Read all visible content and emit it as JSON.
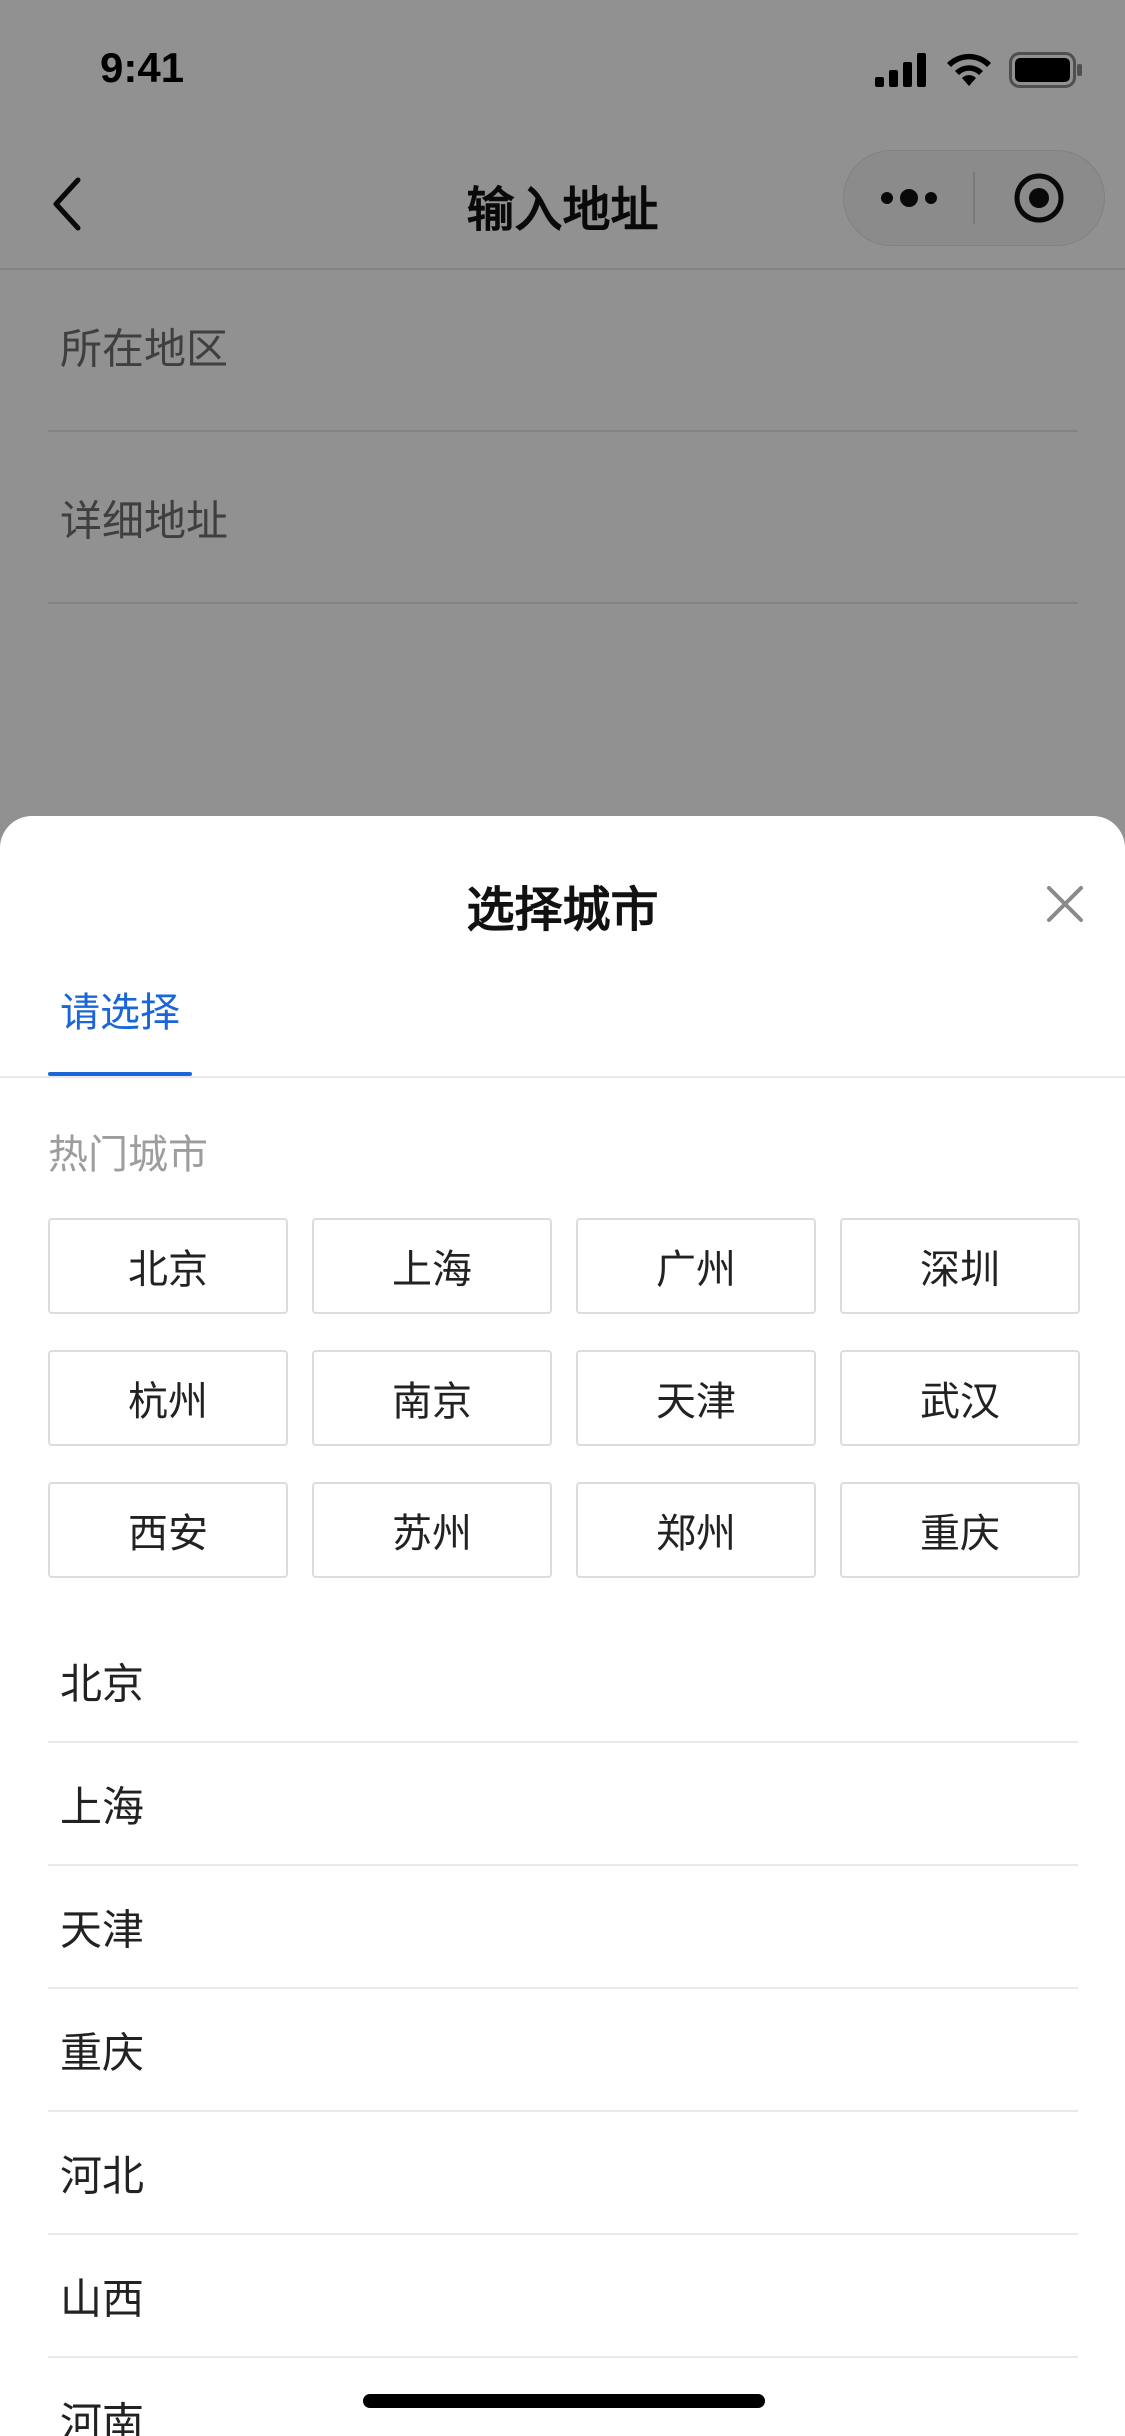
{
  "status_bar": {
    "time": "9:41"
  },
  "navbar": {
    "title": "输入地址"
  },
  "form": {
    "region_placeholder": "所在地区",
    "detail_placeholder": "详细地址"
  },
  "sheet": {
    "title": "选择城市",
    "tab_label": "请选择",
    "hot_title": "热门城市",
    "hot_cities": [
      "北京",
      "上海",
      "广州",
      "深圳",
      "杭州",
      "南京",
      "天津",
      "武汉",
      "西安",
      "苏州",
      "郑州",
      "重庆"
    ],
    "regions": [
      "北京",
      "上海",
      "天津",
      "重庆",
      "河北",
      "山西",
      "河南"
    ]
  },
  "colors": {
    "accent": "#1a66d9",
    "overlay": "rgba(0,0,0,0.43)"
  }
}
